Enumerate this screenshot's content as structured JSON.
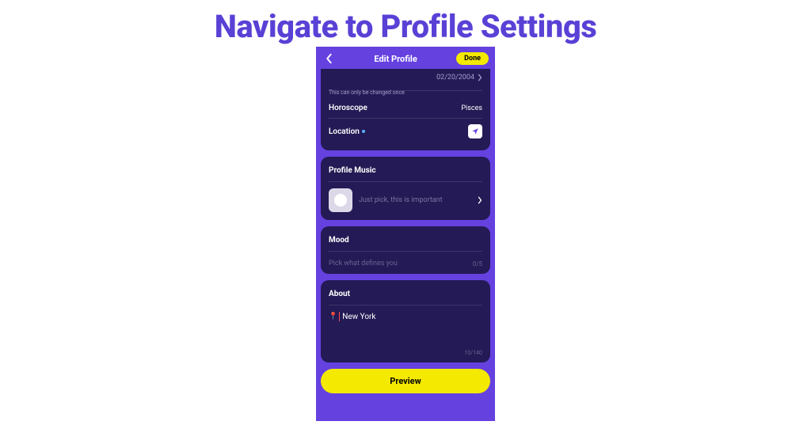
{
  "pageTitle": "Navigate to Profile Settings",
  "header": {
    "title": "Edit Profile",
    "done": "Done"
  },
  "date": {
    "value": "02/20/2004",
    "note": "This can only be changed once"
  },
  "horoscope": {
    "label": "Horoscope",
    "value": "Pisces"
  },
  "location": {
    "label": "Location"
  },
  "music": {
    "title": "Profile Music",
    "placeholder": "Just pick, this is important"
  },
  "mood": {
    "title": "Mood",
    "placeholder": "Pick what defines you",
    "count": "0/5"
  },
  "about": {
    "title": "About",
    "pin": "📍",
    "text": "New York",
    "count": "10/140"
  },
  "preview": "Preview"
}
